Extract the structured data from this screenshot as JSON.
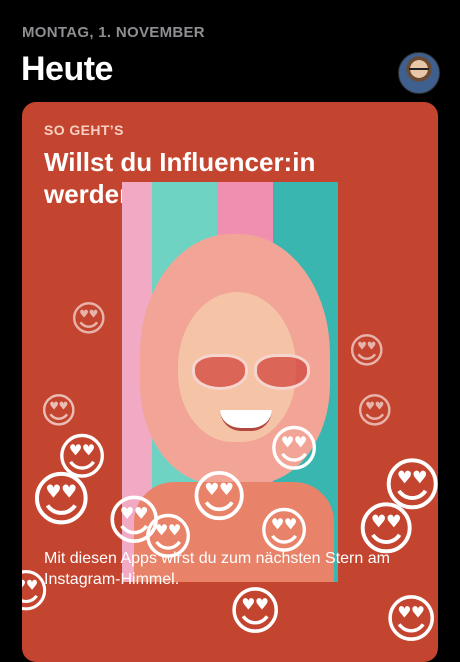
{
  "header": {
    "date": "MONTAG, 1. NOVEMBER",
    "title": "Heute"
  },
  "card": {
    "kicker": "SO GEHT’S",
    "headline": "Willst du Influencer:in werden?",
    "description": "Mit diesen Apps wirst du zum nächsten Stern am Instagram-Himmel.",
    "background_color": "#c4452f"
  },
  "decoration": {
    "emoji": "😍"
  }
}
